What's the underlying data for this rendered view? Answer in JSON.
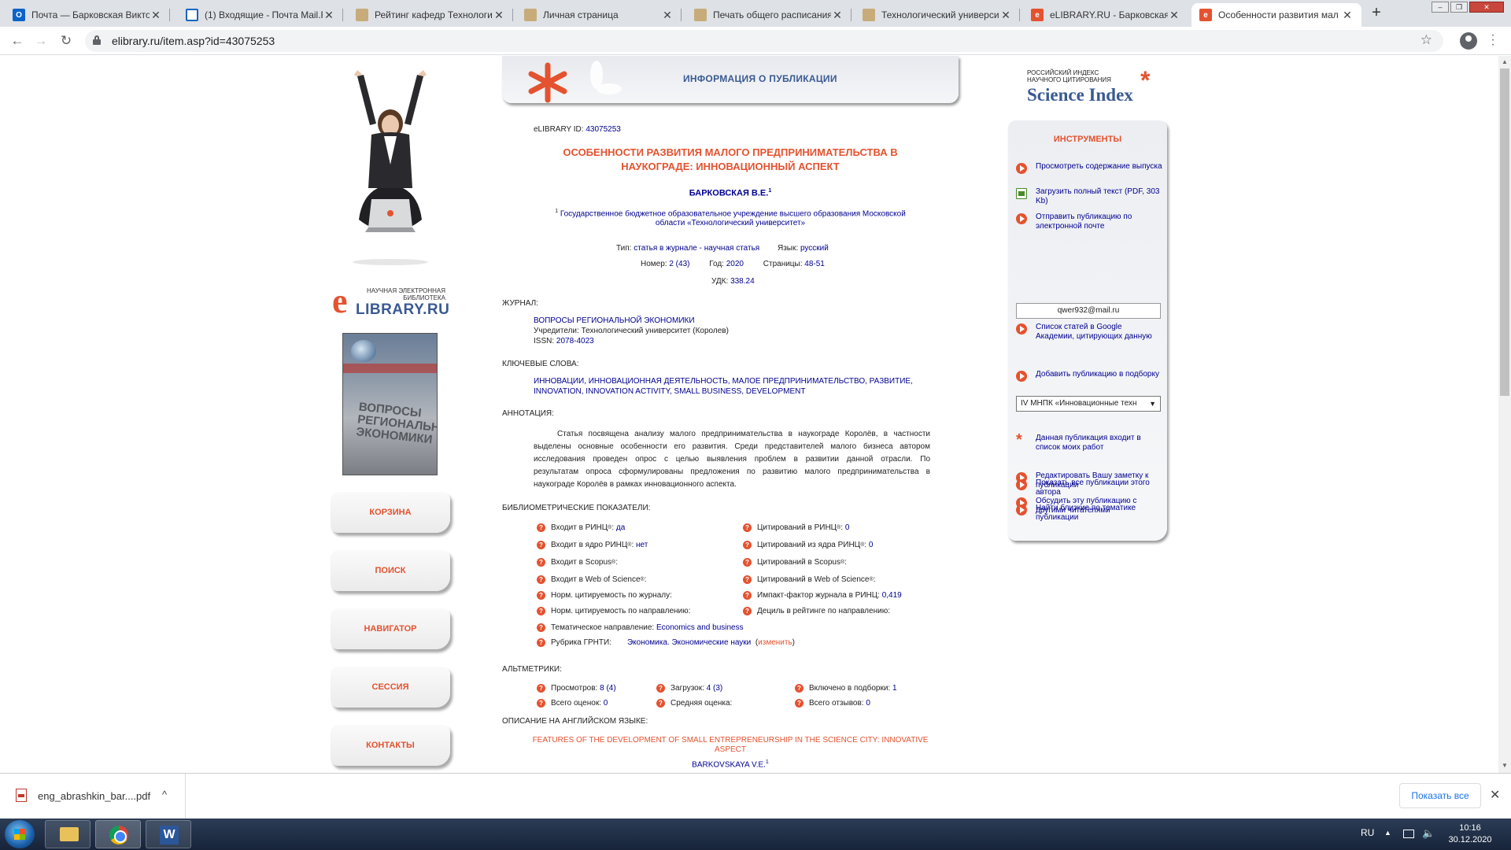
{
  "browser": {
    "tabs": [
      {
        "label": "Почта — Барковская Викто",
        "icon": "outlook-icon"
      },
      {
        "label": "(1) Входящие - Почта Mail.R",
        "icon": "mail-icon"
      },
      {
        "label": "Рейтинг кафедр Технологич",
        "icon": "university-hat-icon"
      },
      {
        "label": "Личная страница",
        "icon": "university-hat-icon"
      },
      {
        "label": "Печать общего расписания",
        "icon": "university-hat-icon"
      },
      {
        "label": "Технологический универси",
        "icon": "university-hat-icon"
      },
      {
        "label": "eLIBRARY.RU - Барковская В",
        "icon": "elibrary-icon"
      },
      {
        "label": "Особенности развития мал",
        "icon": "elibrary-icon"
      }
    ],
    "url": "elibrary.ru/item.asp?id=43075253"
  },
  "left": {
    "elib_small": "НАУЧНАЯ ЭЛЕКТРОННАЯ БИБЛИОТЕКА",
    "elib_big": "LIBRARY.RU",
    "elib_e": "e",
    "cover_text": "ВОПРОСЫ РЕГИОНАЛЬНОЙ ЭКОНОМИКИ",
    "buttons": [
      "КОРЗИНА",
      "ПОИСК",
      "НАВИГАТОР",
      "СЕССИЯ",
      "КОНТАКТЫ"
    ]
  },
  "header": {
    "title": "ИНФОРМАЦИЯ О ПУБЛИКАЦИИ"
  },
  "pub": {
    "id_label": "eLIBRARY ID:",
    "id": "43075253",
    "title_line1": "ОСОБЕННОСТИ РАЗВИТИЯ МАЛОГО ПРЕДПРИНИМАТЕЛЬСТВА В",
    "title_line2": "НАУКОГРАДЕ: ИННОВАЦИОННЫЙ АСПЕКТ",
    "author": "БАРКОВСКАЯ В.Е.",
    "author_sup": "1",
    "affil_sup": "1",
    "affil_line1": "Государственное бюджетное образовательное учреждение высшего образования Московской",
    "affil_line2": "области «Технологический университет»",
    "type_label": "Тип:",
    "type_value": "статья в журнале - научная статья",
    "lang_label": "Язык:",
    "lang_value": "русский",
    "num_label": "Номер:",
    "num_value": "2 (43)",
    "year_label": "Год:",
    "year_value": "2020",
    "pages_label": "Страницы:",
    "pages_value": "48-51",
    "udk_label": "УДК:",
    "udk_value": "338.24"
  },
  "journal": {
    "section": "ЖУРНАЛ:",
    "name": "ВОПРОСЫ РЕГИОНАЛЬНОЙ ЭКОНОМИКИ",
    "founder_label": "Учредители:",
    "founder": "Технологический университет (Королев)",
    "issn_label": "ISSN:",
    "issn": "2078-4023"
  },
  "keywords": {
    "section": "КЛЮЧЕВЫЕ СЛОВА:",
    "line1": "ИННОВАЦИИ, ИННОВАЦИОННАЯ ДЕЯТЕЛЬНОСТЬ, МАЛОЕ ПРЕДПРИНИМАТЕЛЬСТВО, РАЗВИТИЕ,",
    "line2": "INNOVATION, INNOVATION ACTIVITY, SMALL BUSINESS, DEVELOPMENT"
  },
  "abstract": {
    "section": "АННОТАЦИЯ:",
    "lines": [
      "Статья посвящена анализу малого предпринимательства в наукограде Королёв, в частности",
      "выделены основные особенности его развития. Среди представителей малого бизнеса автором",
      "исследования проведен опрос с целью выявления проблем в развитии данной отрасли. По",
      "результатам опроса сформулированы предложения по развитию малого предпринимательства в",
      "наукограде Королёв в рамках инновационного аспекта."
    ]
  },
  "biblio": {
    "section": "БИБЛИОМЕТРИЧЕСКИЕ ПОКАЗАТЕЛИ:",
    "left": [
      {
        "label": "Входит в РИНЦ",
        "sup": "®",
        "sep": ":",
        "value": "да"
      },
      {
        "label": "Входит в ядро РИНЦ",
        "sup": "®",
        "sep": ":",
        "value": "нет"
      },
      {
        "label": "Входит в Scopus",
        "sup": "®",
        "sep": ":",
        "value": ""
      },
      {
        "label": "Входит в Web of Science",
        "sup": "®",
        "sep": ":",
        "value": ""
      },
      {
        "label": "Норм. цитируемость по журналу:",
        "sup": "",
        "sep": "",
        "value": ""
      },
      {
        "label": "Норм. цитируемость по направлению:",
        "sup": "",
        "sep": "",
        "value": ""
      }
    ],
    "right": [
      {
        "label": "Цитирований в РИНЦ",
        "sup": "®",
        "sep": ":",
        "value": "0"
      },
      {
        "label": "Цитирований из ядра РИНЦ",
        "sup": "®",
        "sep": ":",
        "value": "0"
      },
      {
        "label": "Цитирований в Scopus",
        "sup": "®",
        "sep": ":",
        "value": ""
      },
      {
        "label": "Цитирований в Web of Science",
        "sup": "®",
        "sep": ":",
        "value": ""
      },
      {
        "label": "Импакт-фактор журнала в РИНЦ:",
        "sup": "",
        "sep": "",
        "value": "0,419"
      },
      {
        "label": "Дециль в рейтинге по направлению:",
        "sup": "",
        "sep": "",
        "value": ""
      }
    ],
    "thematic_label": "Тематическое направление:",
    "thematic_value": "Economics and business",
    "grnti_label": "Рубрика ГРНТИ:",
    "grnti_value": "Экономика. Экономические науки",
    "grnti_change": "изменить"
  },
  "altmetrics": {
    "section": "АЛЬТМЕТРИКИ:",
    "items": [
      {
        "label": "Просмотров:",
        "value": "8 (4)"
      },
      {
        "label": "Загрузок:",
        "value": "4 (3)"
      },
      {
        "label": "Включено в подборки:",
        "value": "1"
      },
      {
        "label": "Всего оценок:",
        "value": "0"
      },
      {
        "label": "Средняя оценка:",
        "value": ""
      },
      {
        "label": "Всего отзывов:",
        "value": "0"
      }
    ]
  },
  "english": {
    "section": "ОПИСАНИЕ НА АНГЛИЙСКОМ ЯЗЫКЕ:",
    "title_line1": "FEATURES OF THE DEVELOPMENT OF SMALL ENTREPRENEURSHIP IN THE SCIENCE CITY: INNOVATIVE",
    "title_line2": "ASPECT",
    "author": "BARKOVSKAYA V.E.",
    "author_sup": "1"
  },
  "science_index": {
    "small_line1": "РОССИЙСКИЙ ИНДЕКС",
    "small_line2": "НАУЧНОГО ЦИТИРОВАНИЯ",
    "big": "Science Index",
    "ast": "*"
  },
  "tools": {
    "title": "ИНСТРУМЕНТЫ",
    "items": [
      "Просмотреть содержание выпуска",
      "Загрузить полный текст (PDF, 303 Kb)",
      "Отправить публикацию по электронной почте",
      "Список статей в Google Академии, цитирующих данную",
      "Добавить публикацию в подборку",
      "Данная публикация входит в список моих работ",
      "Редактировать Вашу заметку к публикации",
      "Обсудить эту публикацию с другими читателями",
      "Показать все публикации этого автора",
      "Найти близкие по тематике публикации"
    ],
    "email_value": "qwer932@mail.ru",
    "collection_selected": "IV МНПК «Инновационные техн"
  },
  "downloads": {
    "file": "eng_abrashkin_bar....pdf",
    "show_all": "Показать все"
  },
  "taskbar": {
    "lang": "RU",
    "time": "10:16",
    "date": "30.12.2020"
  },
  "colors": {
    "accent": "#e4522f",
    "link": "#00008f",
    "brand_blue": "#3a5a92"
  }
}
